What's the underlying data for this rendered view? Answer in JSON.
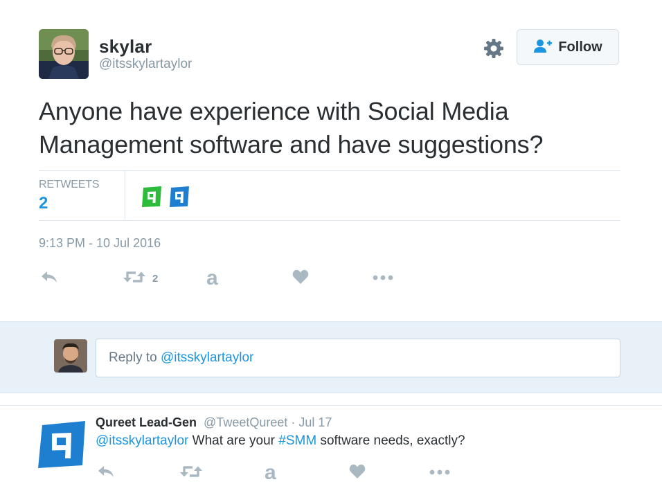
{
  "tweet": {
    "author_name": "skylar",
    "author_handle": "@itsskylartaylor",
    "text": "Anyone have experience with Social Media Management software and have suggestions?",
    "follow_label": "Follow",
    "stats": {
      "retweets_label": "RETWEETS",
      "retweets_count": "2"
    },
    "timestamp": "9:13 PM - 10 Jul 2016",
    "actions": {
      "retweet_count": "2",
      "amazon_glyph": "a"
    }
  },
  "reply_box": {
    "prefix": "Reply to ",
    "mention": "@itsskylartaylor"
  },
  "reply": {
    "author_name": "Qureet Lead-Gen",
    "meta": "@TweetQureet · Jul 17",
    "mention": "@itsskylartaylor",
    "text_mid": " What are your ",
    "hashtag": "#SMM",
    "text_end": " software needs, exactly?",
    "amazon_glyph": "a"
  },
  "colors": {
    "link_blue": "#1b95e0",
    "muted_gray": "#8899a6",
    "reply_bg": "#e8f1f8",
    "qureet_green": "#2dbb3b",
    "qureet_blue": "#1e7fd0"
  },
  "icons": [
    "gear-icon",
    "follow-person-icon",
    "reply-icon",
    "retweet-icon",
    "amazon-icon",
    "heart-icon",
    "more-icon"
  ]
}
